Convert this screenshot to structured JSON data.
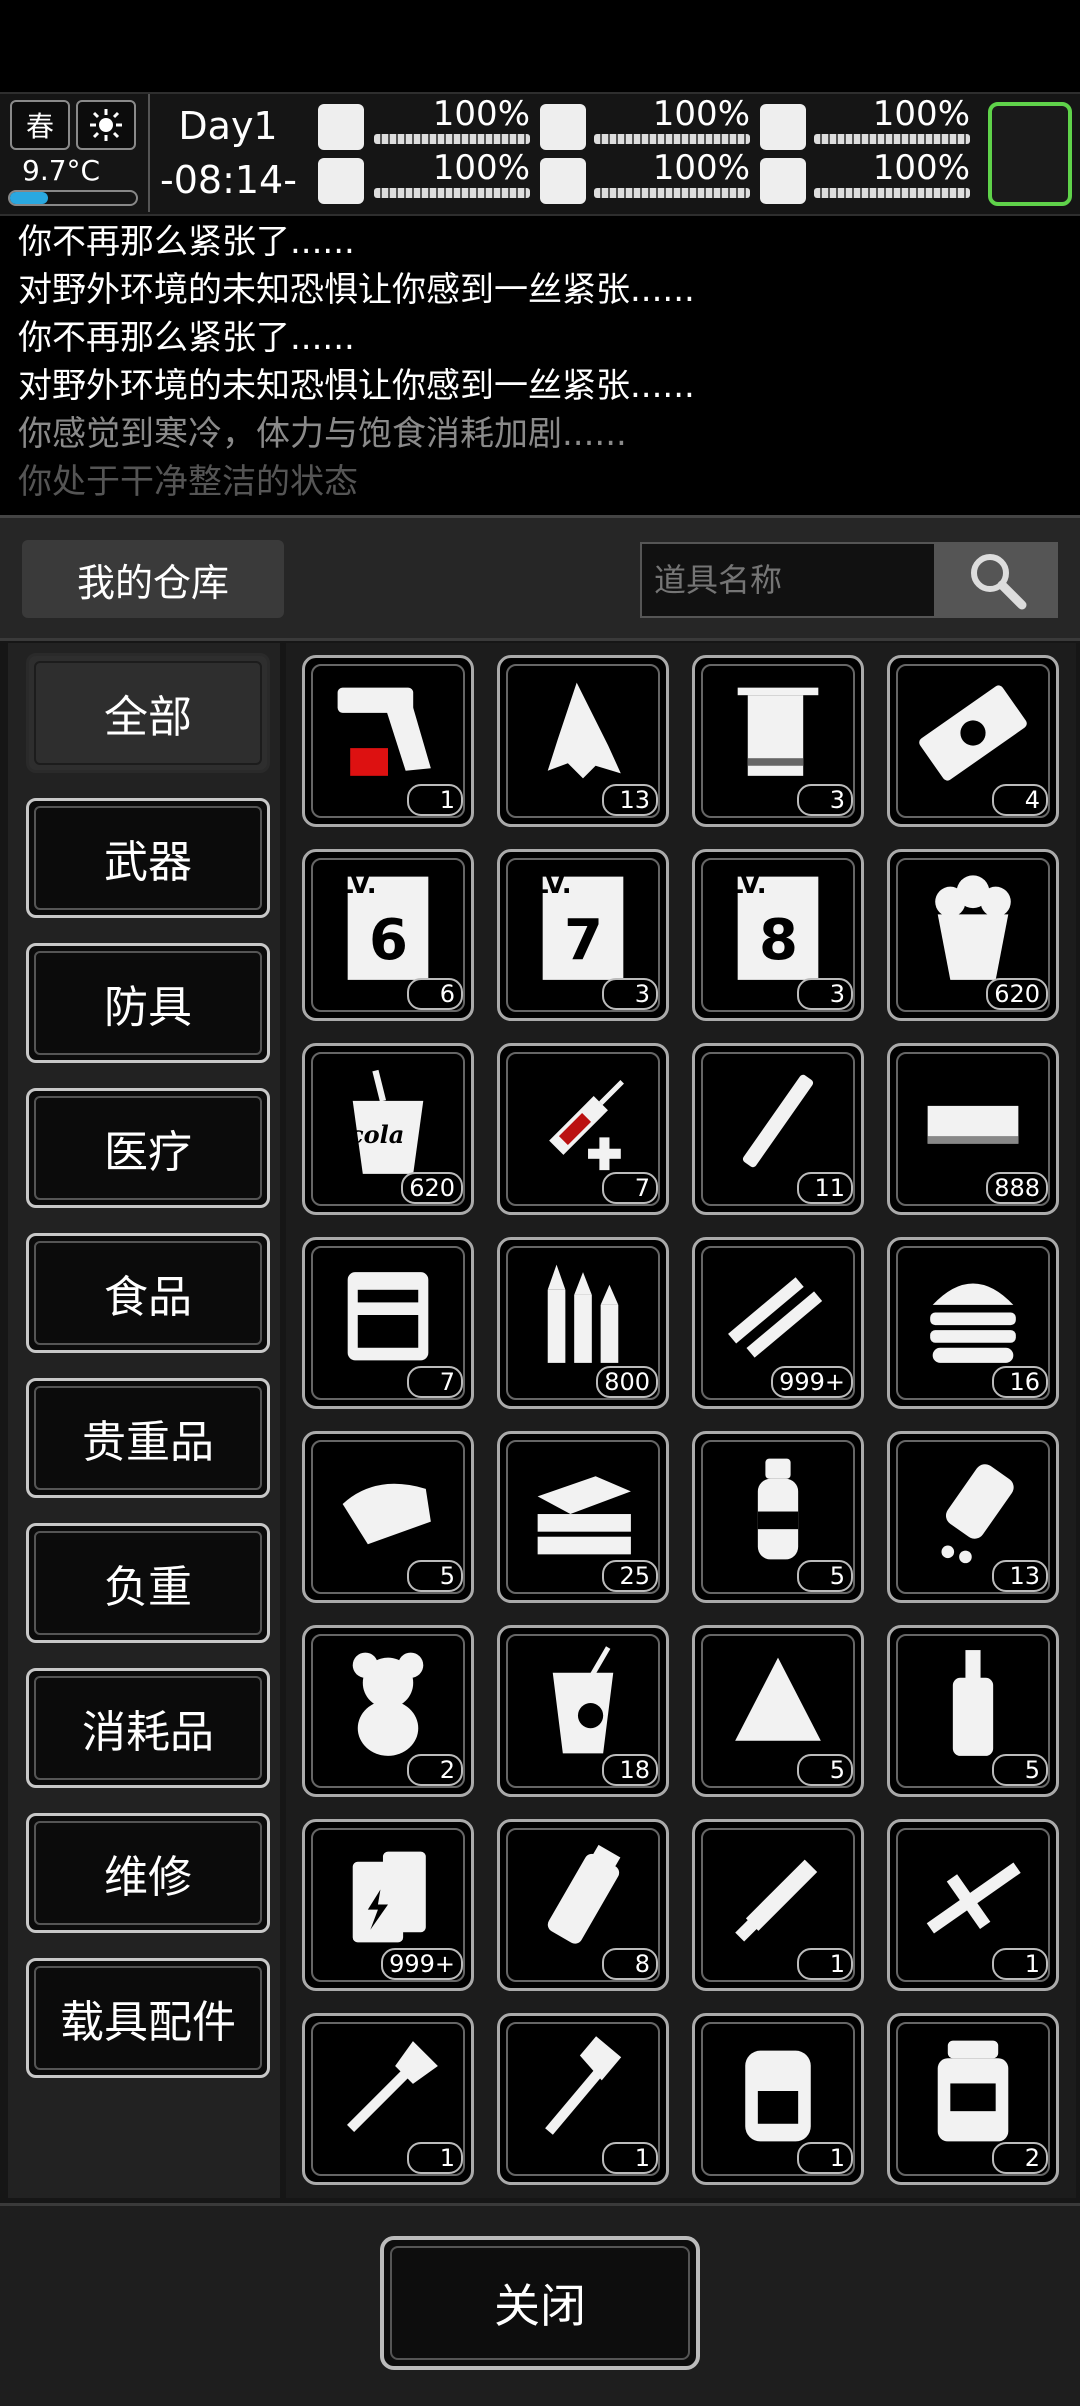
{
  "hud": {
    "season": "春",
    "temperature": "9.7°C",
    "day": "Day1",
    "time": "-08:14-",
    "stats": {
      "health": "100%",
      "hunger": "100%",
      "sanity": "100%",
      "stamina": "100%",
      "thirst": "100%",
      "mood": "100%"
    }
  },
  "log": [
    "你不再那么紧张了......",
    "对野外环境的未知恐惧让你感到一丝紧张......",
    "你不再那么紧张了......",
    "对野外环境的未知恐惧让你感到一丝紧张......",
    "你感觉到寒冷，体力与饱食消耗加剧......",
    "你处于干净整洁的状态"
  ],
  "warehouse": {
    "title": "我的仓库",
    "search_placeholder": "道具名称"
  },
  "categories": [
    "全部",
    "武器",
    "防具",
    "医疗",
    "食品",
    "贵重品",
    "负重",
    "消耗品",
    "维修",
    "载具配件"
  ],
  "items": [
    {
      "icon": "flare-gun-icon",
      "qty": "1"
    },
    {
      "icon": "torn-cloth-icon",
      "qty": "13"
    },
    {
      "icon": "towel-icon",
      "qty": "3"
    },
    {
      "icon": "ticket-icon",
      "qty": "4"
    },
    {
      "icon": "skill-book-lv6-icon",
      "qty": "6",
      "label": "LV.",
      "level": "6"
    },
    {
      "icon": "skill-book-lv7-icon",
      "qty": "3",
      "label": "LV.",
      "level": "7"
    },
    {
      "icon": "skill-book-lv8-icon",
      "qty": "3",
      "label": "LV.",
      "level": "8"
    },
    {
      "icon": "popcorn-icon",
      "qty": "620"
    },
    {
      "icon": "cola-cup-icon",
      "qty": "620",
      "label": "cola"
    },
    {
      "icon": "syringe-icon",
      "qty": "7"
    },
    {
      "icon": "cigarette-icon",
      "qty": "11"
    },
    {
      "icon": "cash-stack-icon",
      "qty": "888"
    },
    {
      "icon": "tool-kit-icon",
      "qty": "7"
    },
    {
      "icon": "bullets-icon",
      "qty": "800"
    },
    {
      "icon": "rifle-ammo-icon",
      "qty": "999+"
    },
    {
      "icon": "burger-icon",
      "qty": "16"
    },
    {
      "icon": "bread-slice-icon",
      "qty": "5"
    },
    {
      "icon": "sandwich-icon",
      "qty": "25"
    },
    {
      "icon": "spray-bottle-icon",
      "qty": "5"
    },
    {
      "icon": "pill-bottle-icon",
      "qty": "13"
    },
    {
      "icon": "teddy-bear-icon",
      "qty": "2"
    },
    {
      "icon": "juice-glass-icon",
      "qty": "18"
    },
    {
      "icon": "rice-dumpling-icon",
      "qty": "5"
    },
    {
      "icon": "liquor-bottle-icon",
      "qty": "5"
    },
    {
      "icon": "battery-icon",
      "qty": "999+"
    },
    {
      "icon": "grenade-icon",
      "qty": "8"
    },
    {
      "icon": "machete-icon",
      "qty": "1"
    },
    {
      "icon": "crossbow-icon",
      "qty": "1"
    },
    {
      "icon": "shovel-icon",
      "qty": "1"
    },
    {
      "icon": "axe-icon",
      "qty": "1"
    },
    {
      "icon": "backpack-icon",
      "qty": "1"
    },
    {
      "icon": "hiking-backpack-icon",
      "qty": "2"
    }
  ],
  "footer": {
    "close_label": "关闭"
  },
  "colors": {
    "accent_green": "#5fd24a",
    "panel_bg": "#161616"
  }
}
